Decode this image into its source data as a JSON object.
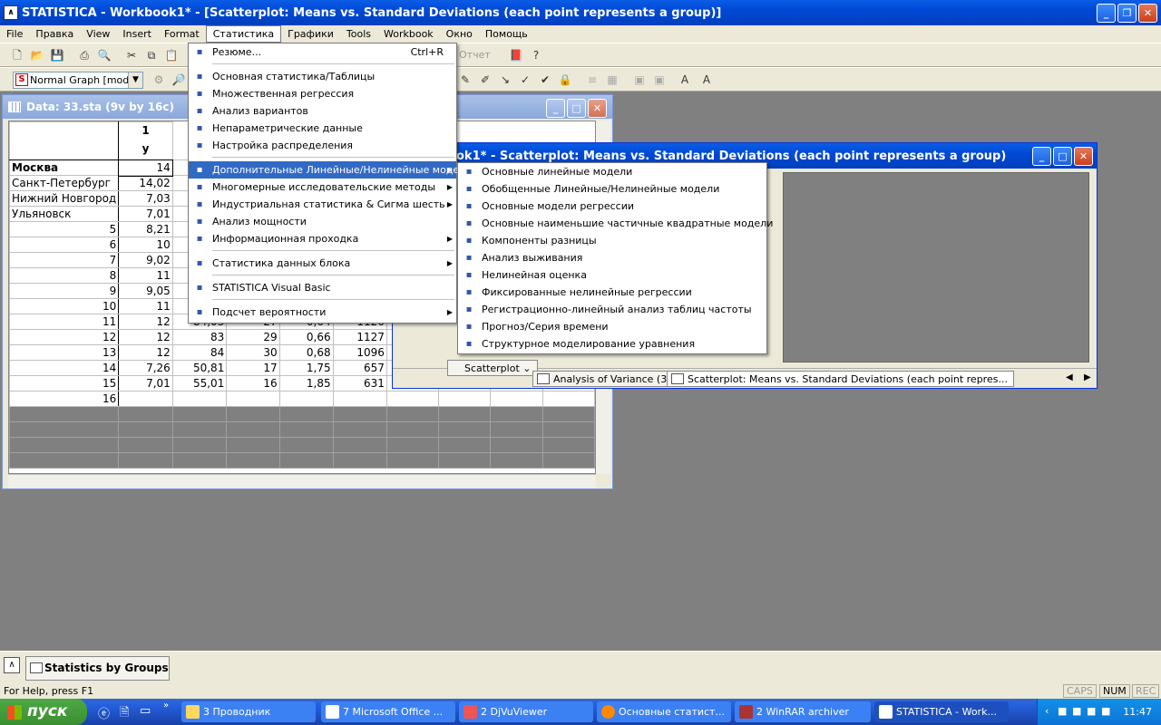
{
  "window": {
    "title": "STATISTICA - Workbook1* - [Scatterplot: Means vs. Standard Deviations (each point represents a group)]",
    "app_icon": "statistica-icon"
  },
  "menubar": [
    "File",
    "Правка",
    "View",
    "Insert",
    "Format",
    "Статистика",
    "Графики",
    "Tools",
    "Workbook",
    "Окно",
    "Помощь"
  ],
  "toolbar": {
    "graph_select": "Normal Graph [modi...",
    "report_label": "Отчет"
  },
  "data_window": {
    "title": "Data: 33.sta (9v by 16c)",
    "col_header_num": "1",
    "col_header_var": "y",
    "rows": [
      {
        "label": "Москва",
        "cells": [
          "14",
          "",
          "",
          "",
          "",
          "",
          "",
          "",
          ""
        ]
      },
      {
        "label": "Санкт-Петербург",
        "cells": [
          "14,02",
          "",
          "",
          "",
          "",
          "",
          "",
          "",
          ""
        ]
      },
      {
        "label": "Нижний Новгород",
        "cells": [
          "7,03",
          "",
          "",
          "",
          "",
          "",
          "",
          "",
          ""
        ]
      },
      {
        "label": "Ульяновск",
        "cells": [
          "7,01",
          "",
          "",
          "",
          "",
          "",
          "",
          "",
          ""
        ]
      },
      {
        "label": "5",
        "cells": [
          "8,21",
          "",
          "",
          "",
          "",
          "",
          "",
          "",
          ""
        ]
      },
      {
        "label": "6",
        "cells": [
          "10",
          "",
          "",
          "",
          "",
          "",
          "",
          "",
          ""
        ]
      },
      {
        "label": "7",
        "cells": [
          "9,02",
          "",
          "",
          "",
          "",
          "",
          "",
          "",
          ""
        ]
      },
      {
        "label": "8",
        "cells": [
          "11",
          "",
          "",
          "",
          "",
          "",
          "",
          "",
          ""
        ]
      },
      {
        "label": "9",
        "cells": [
          "9,05",
          "",
          "",
          "",
          "",
          "",
          "",
          "",
          ""
        ]
      },
      {
        "label": "10",
        "cells": [
          "11",
          "",
          "",
          "",
          "",
          "",
          "",
          "",
          ""
        ]
      },
      {
        "label": "11",
        "cells": [
          "12",
          "84,03",
          "27",
          "0,64",
          "1126",
          "",
          "",
          "",
          ""
        ]
      },
      {
        "label": "12",
        "cells": [
          "12",
          "83",
          "29",
          "0,66",
          "1127",
          "",
          "",
          "",
          ""
        ]
      },
      {
        "label": "13",
        "cells": [
          "12",
          "84",
          "30",
          "0,68",
          "1096",
          "",
          "",
          "",
          ""
        ]
      },
      {
        "label": "14",
        "cells": [
          "7,26",
          "50,81",
          "17",
          "1,75",
          "657",
          "",
          "",
          "",
          ""
        ]
      },
      {
        "label": "15",
        "cells": [
          "7,01",
          "55,01",
          "16",
          "1,85",
          "631",
          "",
          "",
          "",
          ""
        ]
      },
      {
        "label": "16",
        "cells": [
          "",
          "",
          "",
          "",
          "",
          "",
          "",
          "",
          ""
        ]
      }
    ]
  },
  "scatter_window": {
    "title_fragment": "ok1* - Scatterplot: Means vs. Standard Deviations (each point represents a group)",
    "tabs": [
      "Scatterplot",
      "Analysis of Variance (33)",
      "Scatterplot: Means vs. Standard Deviations (each point repres..."
    ]
  },
  "main_menu": [
    {
      "label": "Резюме...",
      "shortcut": "Ctrl+R",
      "icon": "arrow-icon"
    },
    {
      "sep": true
    },
    {
      "label": "Основная статистика/Таблицы",
      "icon": "chart-icon"
    },
    {
      "label": "Множественная регрессия",
      "icon": "regression-icon"
    },
    {
      "label": "Анализ вариантов",
      "icon": "anova-icon"
    },
    {
      "label": "Непараметрические данные",
      "icon": "nonparam-icon"
    },
    {
      "label": "Настройка распределения",
      "icon": "distribution-icon"
    },
    {
      "sep": true
    },
    {
      "label": "Дополнительные Линейные/Нелинейные модели",
      "arrow": true,
      "highlight": true,
      "icon": "models-icon"
    },
    {
      "label": "Многомерные исследовательские методы",
      "arrow": true,
      "icon": "multivariate-icon"
    },
    {
      "label": "Индустриальная статистика & Сигма шесть",
      "arrow": true,
      "icon": "industrial-icon"
    },
    {
      "label": "Анализ мощности",
      "icon": "power-icon"
    },
    {
      "label": "Информационная проходка",
      "arrow": true,
      "icon": "datamining-icon"
    },
    {
      "sep": true
    },
    {
      "label": "Статистика данных блока",
      "arrow": true,
      "icon": "block-icon"
    },
    {
      "sep": true
    },
    {
      "label": "STATISTICA Visual Basic",
      "icon": "vb-icon"
    },
    {
      "sep": true
    },
    {
      "label": "Подсчет вероятности",
      "arrow": true,
      "icon": "probability-icon"
    }
  ],
  "sub_menu": [
    {
      "label": "Основные линейные модели",
      "icon": "glm-icon"
    },
    {
      "label": "Обобщенные Линейные/Нелинейные модели",
      "icon": "glz-icon"
    },
    {
      "label": "Основные модели регрессии",
      "icon": "grm-icon"
    },
    {
      "label": "Основные наименьшие частичные квадратные модели",
      "icon": "pls-icon"
    },
    {
      "label": "Компоненты разницы",
      "icon": "variance-components-icon"
    },
    {
      "label": "Анализ выживания",
      "icon": "survival-icon"
    },
    {
      "label": "Нелинейная оценка",
      "icon": "nonlinear-icon"
    },
    {
      "label": "Фиксированные нелинейные регрессии",
      "icon": "fixed-nonlinear-icon"
    },
    {
      "label": "Регистрационно-линейный анализ таблиц частоты",
      "icon": "loglinear-icon"
    },
    {
      "label": "Прогноз/Серия времени",
      "icon": "timeseries-icon"
    },
    {
      "label": "Структурное моделирование уравнения",
      "icon": "sem-icon"
    }
  ],
  "minimized": {
    "label": "Statistics by Groups -..."
  },
  "status": {
    "text": "For Help, press F1",
    "caps": "CAPS",
    "num": "NUM",
    "rec": "REC"
  },
  "taskbar": {
    "start": "пуск",
    "tasks": [
      "3 Проводник",
      "7 Microsoft Office ...",
      "2 DjVuViewer",
      "Основные статист...",
      "2 WinRAR archiver",
      "STATISTICA - Work..."
    ],
    "clock": "11:47"
  }
}
